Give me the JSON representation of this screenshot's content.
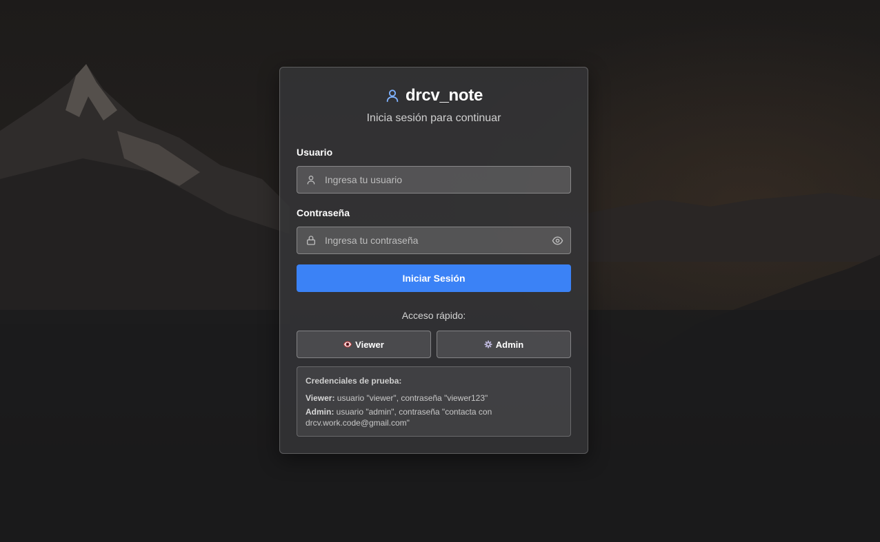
{
  "app": {
    "title": "drcv_note",
    "subtitle": "Inicia sesión para continuar",
    "accent_color": "#3b82f6",
    "brand_icon": "user-icon"
  },
  "form": {
    "username": {
      "label": "Usuario",
      "placeholder": "Ingresa tu usuario",
      "value": "",
      "icon": "user-icon"
    },
    "password": {
      "label": "Contraseña",
      "placeholder": "Ingresa tu contraseña",
      "value": "",
      "icon": "lock-icon",
      "toggle_icon": "eye-icon"
    },
    "submit_label": "Iniciar Sesión"
  },
  "quick_access": {
    "label": "Acceso rápido:",
    "buttons": [
      {
        "label": "Viewer",
        "icon": "eye-icon"
      },
      {
        "label": "Admin",
        "icon": "gear-icon"
      }
    ]
  },
  "credentials": {
    "title": "Credenciales de prueba:",
    "lines": [
      {
        "role": "Viewer:",
        "text": " usuario \"viewer\", contraseña \"viewer123\""
      },
      {
        "role": "Admin:",
        "text": " usuario \"admin\", contraseña \"contacta con drcv.work.code@gmail.com\""
      }
    ]
  }
}
